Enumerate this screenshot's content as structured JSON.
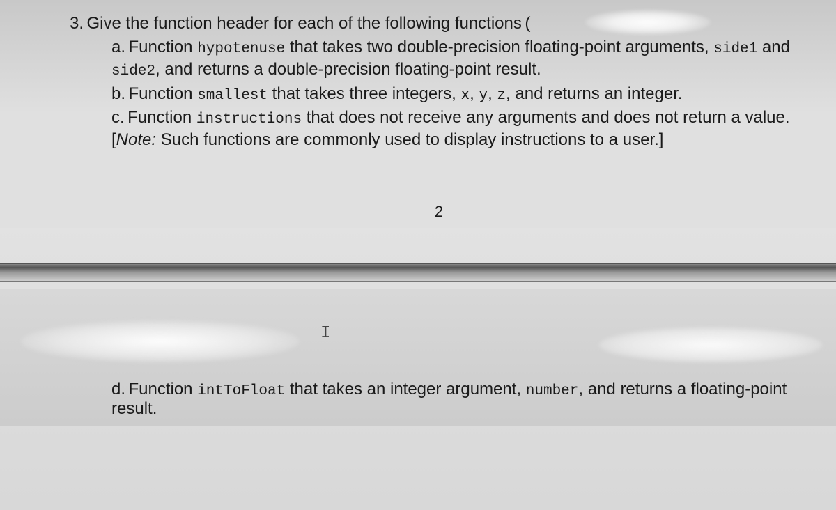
{
  "question": {
    "number": "3.",
    "intro": "Give the function header for each of the following functions",
    "paren_open": "(",
    "paren_close": ").",
    "items": [
      {
        "label": "a.",
        "parts": [
          {
            "t": "text",
            "v": "Function "
          },
          {
            "t": "code",
            "v": "hypotenuse"
          },
          {
            "t": "text",
            "v": " that takes two double-precision floating-point arguments, "
          },
          {
            "t": "code",
            "v": "side1"
          },
          {
            "t": "text",
            "v": " and "
          },
          {
            "t": "code",
            "v": "side2"
          },
          {
            "t": "text",
            "v": ", and returns a double-precision floating-point result."
          }
        ]
      },
      {
        "label": "b.",
        "parts": [
          {
            "t": "text",
            "v": "Function "
          },
          {
            "t": "code",
            "v": "smallest"
          },
          {
            "t": "text",
            "v": " that takes three integers, "
          },
          {
            "t": "code",
            "v": "x"
          },
          {
            "t": "text",
            "v": ", "
          },
          {
            "t": "code",
            "v": "y"
          },
          {
            "t": "text",
            "v": ", "
          },
          {
            "t": "code",
            "v": "z"
          },
          {
            "t": "text",
            "v": ", and returns an integer."
          }
        ]
      },
      {
        "label": "c.",
        "parts": [
          {
            "t": "text",
            "v": "Function "
          },
          {
            "t": "code",
            "v": "instructions"
          },
          {
            "t": "text",
            "v": " that does not receive any arguments and does not return a value. ["
          },
          {
            "t": "italic",
            "v": "Note:"
          },
          {
            "t": "text",
            "v": " Such functions are commonly used to display instructions to a user.]"
          }
        ]
      },
      {
        "label": "d.",
        "parts": [
          {
            "t": "text",
            "v": "Function "
          },
          {
            "t": "code",
            "v": "intToFloat"
          },
          {
            "t": "text",
            "v": " that takes an integer argument, "
          },
          {
            "t": "code",
            "v": "number"
          },
          {
            "t": "text",
            "v": ", and returns a floating-point result."
          }
        ]
      }
    ]
  },
  "page_number": "2",
  "cursor_glyph": "I"
}
